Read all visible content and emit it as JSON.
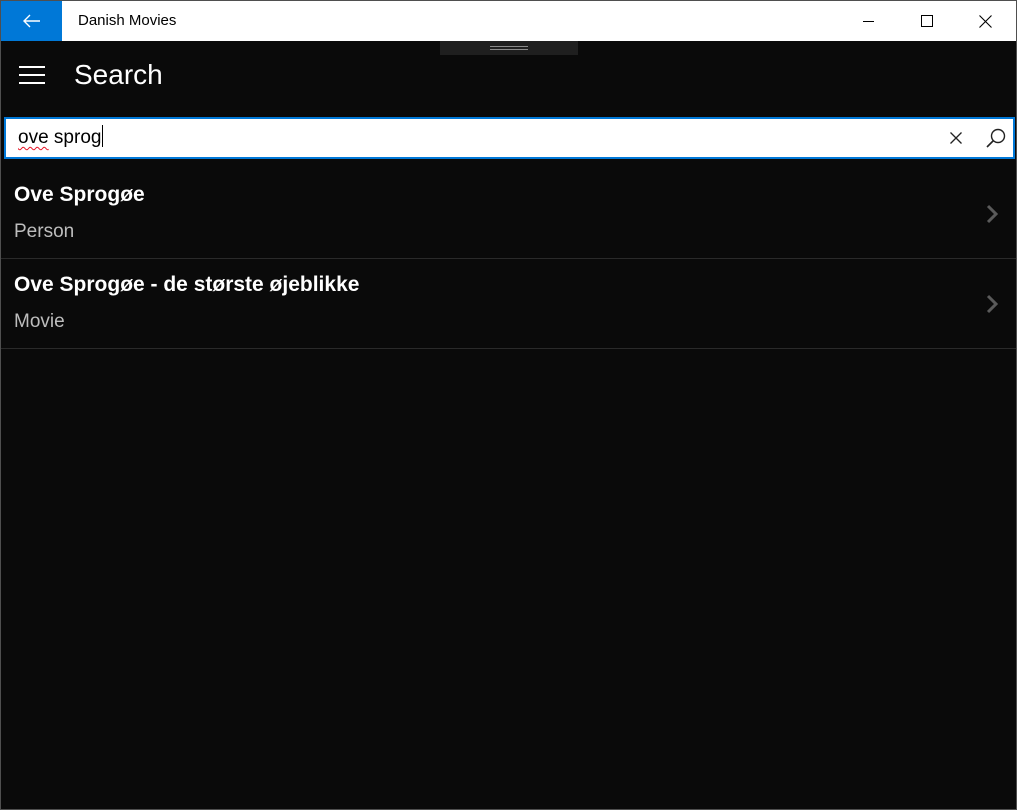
{
  "window": {
    "title": "Danish Movies"
  },
  "header": {
    "page_title": "Search"
  },
  "search": {
    "value_first": "ove",
    "value_rest": " sprog",
    "placeholder": ""
  },
  "results": [
    {
      "title": "Ove Sprogøe",
      "type": "Person"
    },
    {
      "title": "Ove Sprogøe - de største øjeblikke",
      "type": "Movie"
    }
  ],
  "icons": {
    "back": "back-arrow-icon",
    "minimize": "minimize-icon",
    "maximize": "maximize-icon",
    "close": "close-icon",
    "menu": "hamburger-icon",
    "clear": "clear-icon",
    "search": "search-icon",
    "chevron": "chevron-right-icon"
  },
  "colors": {
    "accent": "#0078d7",
    "background": "#0a0a0a",
    "titlebar": "#ffffff",
    "spellcheck": "#e81123"
  }
}
